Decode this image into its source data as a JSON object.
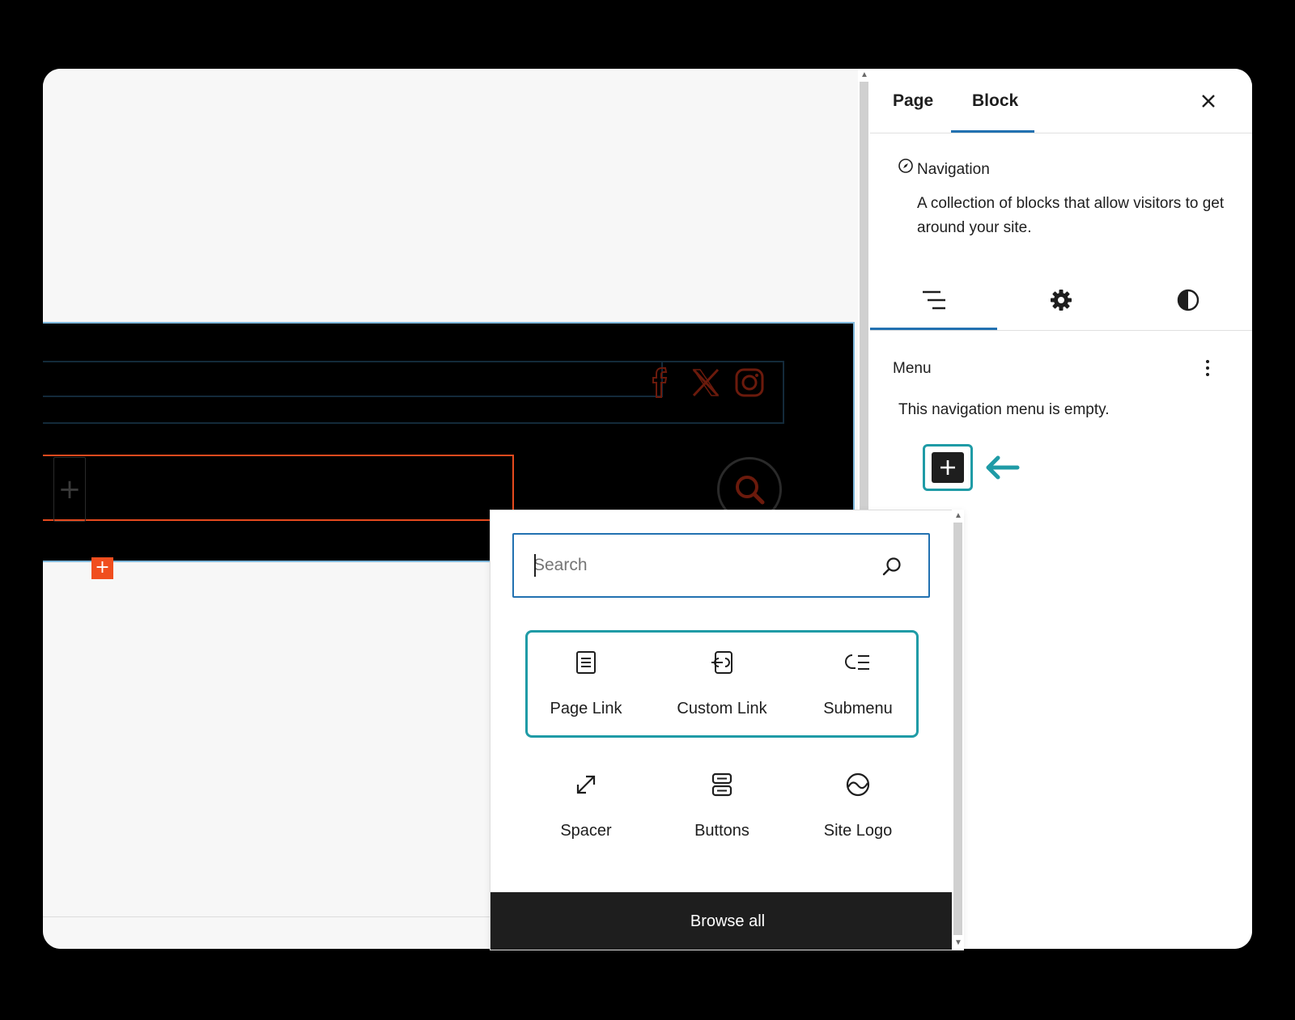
{
  "sidebar": {
    "tabs": [
      {
        "label": "Page"
      },
      {
        "label": "Block"
      }
    ],
    "active_tab": "Block",
    "block_card": {
      "title": "Navigation",
      "description": "A collection of blocks that allow visitors to get around your site."
    },
    "subtabs": [
      "list-view-icon",
      "gear-icon",
      "contrast-icon"
    ],
    "menu": {
      "heading": "Menu",
      "empty_text": "This navigation menu is empty."
    }
  },
  "inserter": {
    "search_placeholder": "Search",
    "blocks": [
      {
        "label": "Page Link",
        "icon": "page-icon"
      },
      {
        "label": "Custom Link",
        "icon": "custom-link-icon"
      },
      {
        "label": "Submenu",
        "icon": "submenu-icon"
      },
      {
        "label": "Spacer",
        "icon": "spacer-icon"
      },
      {
        "label": "Buttons",
        "icon": "buttons-icon"
      },
      {
        "label": "Site Logo",
        "icon": "site-logo-icon"
      }
    ],
    "browse_all_label": "Browse all"
  },
  "colors": {
    "accent_blue": "#2271b1",
    "highlight_teal": "#1f9ba6",
    "orange": "#f04e1e",
    "dark": "#1e1e1e"
  }
}
